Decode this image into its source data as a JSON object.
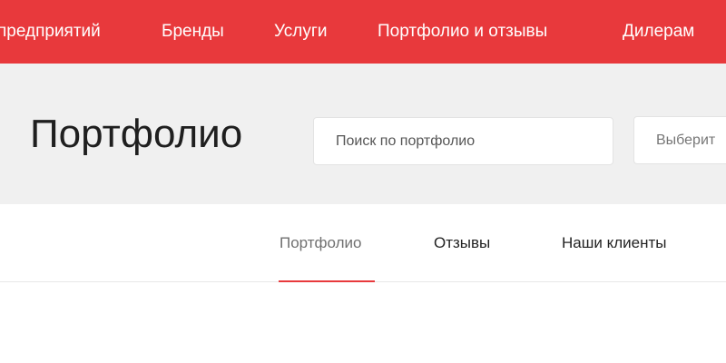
{
  "top_nav": {
    "items": [
      {
        "label": "предприятий"
      },
      {
        "label": "Бренды"
      },
      {
        "label": "Услуги"
      },
      {
        "label": "Портфолио и отзывы"
      },
      {
        "label": "Дилерам"
      }
    ]
  },
  "header": {
    "title": "Портфолио",
    "search_placeholder": "Поиск по портфолио",
    "select_text": "Выберит"
  },
  "tabs": [
    {
      "label": "Портфолио",
      "active": true
    },
    {
      "label": "Отзывы",
      "active": false
    },
    {
      "label": "Наши клиенты",
      "active": false
    }
  ],
  "colors": {
    "accent": "#e8393c",
    "hero_background": "#f0f0f0",
    "text_dark": "#1f1f1f",
    "tab_active_text": "#707070"
  }
}
